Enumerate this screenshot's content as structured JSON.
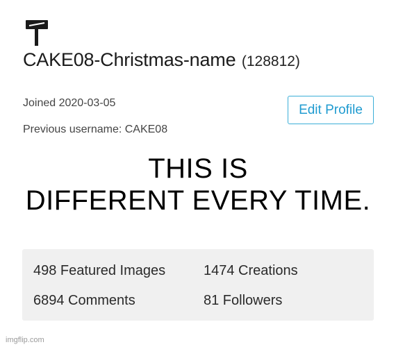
{
  "profile": {
    "pin_icon": "pin-icon",
    "username": "CAKE08-Christmas-name",
    "user_id": "(128812)",
    "joined": "Joined 2020-03-05",
    "previous_username": "Previous username: CAKE08",
    "edit_profile_label": "Edit Profile"
  },
  "overlay": {
    "line1": "THIS IS",
    "line2": "DIFFERENT EVERY TIME."
  },
  "stats": {
    "featured_images": "498 Featured Images",
    "creations": "1474 Creations",
    "comments": "6894 Comments",
    "followers": "81 Followers"
  },
  "watermark": "imgflip.com",
  "colors": {
    "accent": "#1f9bd0",
    "stats_bg": "#f0f0f0"
  }
}
